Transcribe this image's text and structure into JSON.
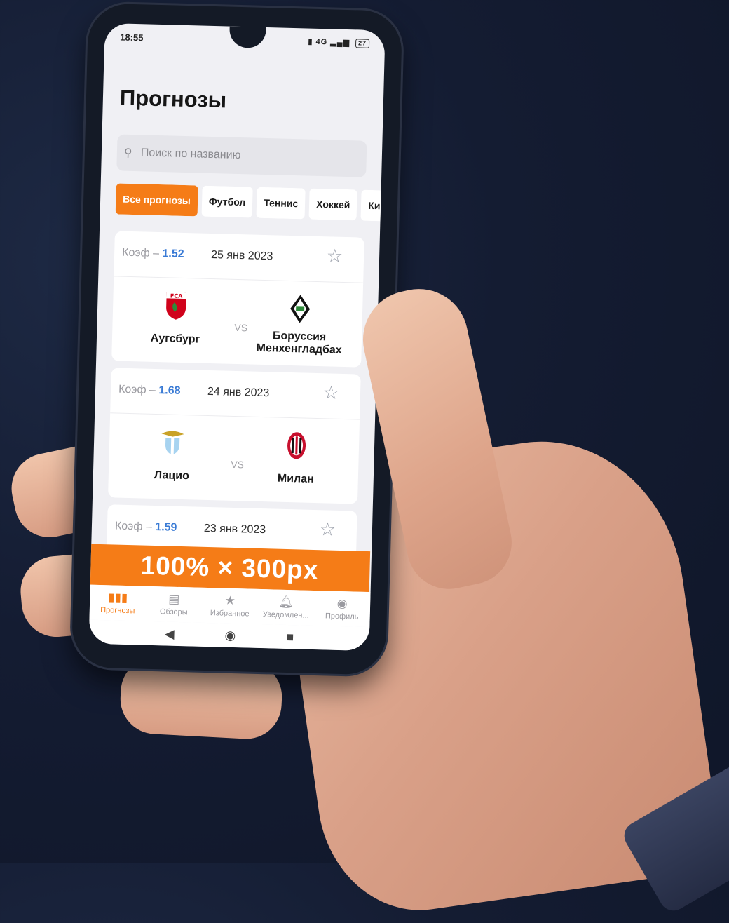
{
  "status_bar": {
    "time": "18:55",
    "signal": "4G",
    "battery": "27"
  },
  "page_title": "Прогнозы",
  "search": {
    "placeholder": "Поиск по названию"
  },
  "filters": [
    "Все прогнозы",
    "Футбол",
    "Теннис",
    "Хоккей",
    "Ки"
  ],
  "matches": [
    {
      "coef_label": "Коэф –",
      "coef": "1.52",
      "date": "25 янв 2023",
      "home": "Аугсбург",
      "away": "Боруссия Менхенгладбах",
      "vs": "VS"
    },
    {
      "coef_label": "Коэф –",
      "coef": "1.68",
      "date": "24 янв 2023",
      "home": "Лацио",
      "away": "Милан",
      "vs": "VS"
    },
    {
      "coef_label": "Коэф –",
      "coef": "1.59",
      "date": "23 янв 2023"
    }
  ],
  "banner_text": "100% × 300px",
  "tabs": [
    {
      "label": "Прогнозы",
      "icon": "forecasts-icon",
      "active": true
    },
    {
      "label": "Обзоры",
      "icon": "reviews-icon"
    },
    {
      "label": "Избранное",
      "icon": "star-icon"
    },
    {
      "label": "Уведомлен...",
      "icon": "bell-icon"
    },
    {
      "label": "Профиль",
      "icon": "profile-icon"
    }
  ],
  "accent_color": "#f57c17",
  "coef_color": "#3a7bd5"
}
